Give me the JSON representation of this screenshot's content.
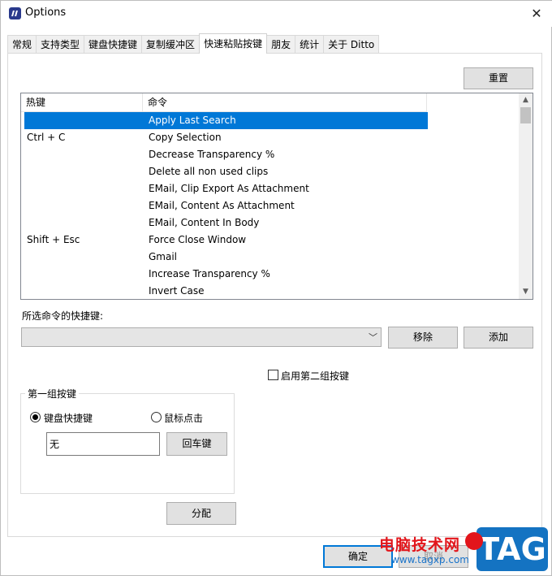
{
  "window": {
    "title": "Options",
    "close_glyph": "✕"
  },
  "tabs": [
    {
      "label": "常规",
      "active": false
    },
    {
      "label": "支持类型",
      "active": false
    },
    {
      "label": "键盘快捷键",
      "active": false
    },
    {
      "label": "复制缓冲区",
      "active": false
    },
    {
      "label": "快速粘贴按键",
      "active": true
    },
    {
      "label": "朋友",
      "active": false
    },
    {
      "label": "统计",
      "active": false
    },
    {
      "label": "关于 Ditto",
      "active": false
    }
  ],
  "toolbar": {
    "reset_label": "重置"
  },
  "list": {
    "columns": [
      "热键",
      "命令"
    ],
    "rows": [
      {
        "hotkey": "",
        "command": "Apply Last Search",
        "selected": true
      },
      {
        "hotkey": "Ctrl + C",
        "command": "Copy Selection"
      },
      {
        "hotkey": "",
        "command": "Decrease Transparency %"
      },
      {
        "hotkey": "",
        "command": "Delete all non used clips"
      },
      {
        "hotkey": "",
        "command": "EMail, Clip Export As Attachment"
      },
      {
        "hotkey": "",
        "command": "EMail, Content As Attachment"
      },
      {
        "hotkey": "",
        "command": "EMail, Content In Body"
      },
      {
        "hotkey": "Shift + Esc",
        "command": "Force Close Window"
      },
      {
        "hotkey": "",
        "command": "Gmail"
      },
      {
        "hotkey": "",
        "command": "Increase Transparency %"
      },
      {
        "hotkey": "",
        "command": "Invert Case"
      }
    ]
  },
  "shortcut": {
    "label": "所选命令的快捷键:",
    "combo_value": "",
    "remove_label": "移除",
    "add_label": "添加"
  },
  "second_group": {
    "label": "启用第二组按键",
    "checked": false
  },
  "first_group": {
    "title": "第一组按键",
    "keyboard_label": "键盘快捷键",
    "mouse_label": "鼠标点击",
    "keyboard_selected": true,
    "key_value": "无",
    "enter_label": "回车键"
  },
  "assign_label": "分配",
  "footer": {
    "ok_label": "确定",
    "cancel_label": "取消"
  },
  "watermark": {
    "site_name": "电脑技术网",
    "url": "www.tagxp.com",
    "logo_text": "TAG"
  },
  "colors": {
    "selection": "#0078d7",
    "button_face": "#e1e1e1"
  }
}
